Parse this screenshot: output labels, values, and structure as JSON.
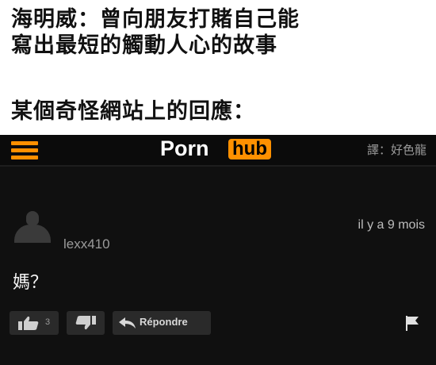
{
  "caption": {
    "line1": "海明威：曾向朋友打賭自己能",
    "line2": "寫出最短的觸動人心的故事",
    "line3": "某個奇怪網站上的回應："
  },
  "site": {
    "logo_left": "Porn",
    "logo_right": "hub",
    "translator_credit": "譯：好色龍",
    "brand_color": "#ff9000"
  },
  "comment": {
    "username": "lexx410",
    "timestamp": "il y a 9 mois",
    "text": "媽？",
    "likes": "3",
    "reply_label": "Répondre"
  },
  "icons": {
    "menu": "hamburger-icon",
    "avatar": "user-silhouette-icon",
    "like": "thumbs-up-icon",
    "dislike": "thumbs-down-icon",
    "reply": "reply-arrow-icon",
    "flag": "flag-icon"
  }
}
